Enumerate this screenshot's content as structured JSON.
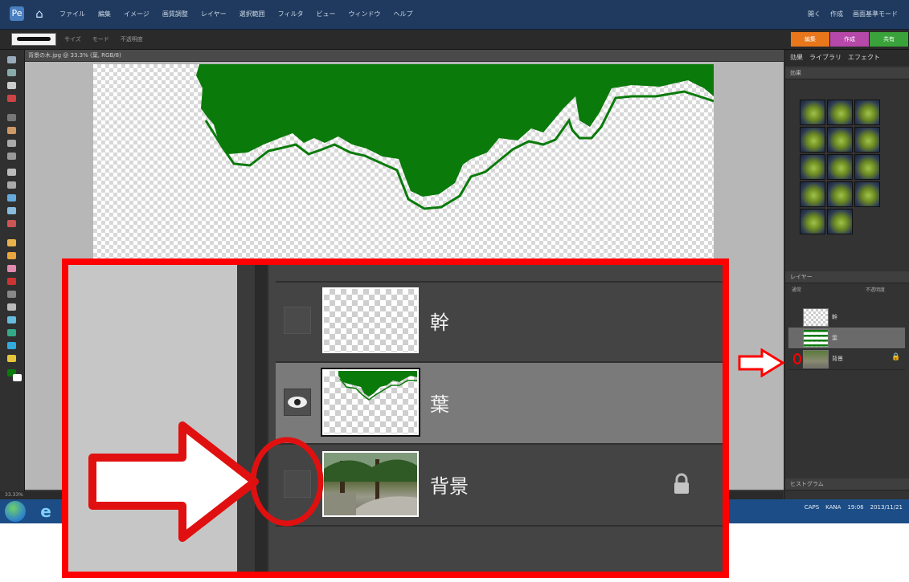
{
  "window": {
    "menus": [
      "ファイル",
      "編集",
      "イメージ",
      "画質調整",
      "レイヤー",
      "選択範囲",
      "フィルタ",
      "ビュー",
      "ウィンドウ",
      "ヘルプ"
    ],
    "menu_right": [
      "開く",
      "作成",
      "画面基準モード"
    ],
    "mode_tabs": [
      {
        "label": "編集",
        "color": "#e8761b"
      },
      {
        "label": "作成",
        "color": "#b548a8"
      },
      {
        "label": "共有",
        "color": "#3aa23a"
      }
    ],
    "options": [
      "サイズ",
      "モード",
      "不透明度"
    ]
  },
  "document": {
    "tab_title": "背景の木.jpg @ 33.3% (葉, RGB/8)",
    "status": "33.33%"
  },
  "right_panel": {
    "tabs": [
      "効果",
      "ライブラリ",
      "エフェクト"
    ],
    "effects_section": "効果",
    "layers_section": "レイヤー",
    "blend_mode": "通常",
    "opacity_label": "不透明度",
    "histogram_section": "ヒストグラム",
    "layers": [
      {
        "name": "幹",
        "visible": false,
        "selected": false,
        "locked": false
      },
      {
        "name": "葉",
        "visible": true,
        "selected": true,
        "locked": false
      },
      {
        "name": "背景",
        "visible": false,
        "selected": false,
        "locked": true
      }
    ]
  },
  "taskbar": {
    "tray_items": [
      "CAPS",
      "KANA",
      "19:06",
      "2013/11/21"
    ]
  },
  "callout": {
    "layers": [
      {
        "name": "幹",
        "visible": false,
        "selected": false,
        "locked": false,
        "thumb": "transparent"
      },
      {
        "name": "葉",
        "visible": true,
        "selected": true,
        "locked": false,
        "thumb": "leaves"
      },
      {
        "name": "背景",
        "visible": false,
        "selected": false,
        "locked": true,
        "thumb": "photo"
      }
    ]
  },
  "colors": {
    "accent_red": "#ff0000",
    "leaf_green": "#0a7a0a",
    "canvas_bg": "#b7b7b7"
  },
  "icons": [
    "visibility-eye-icon",
    "lock-icon",
    "arrow-icon",
    "circle-highlight"
  ]
}
